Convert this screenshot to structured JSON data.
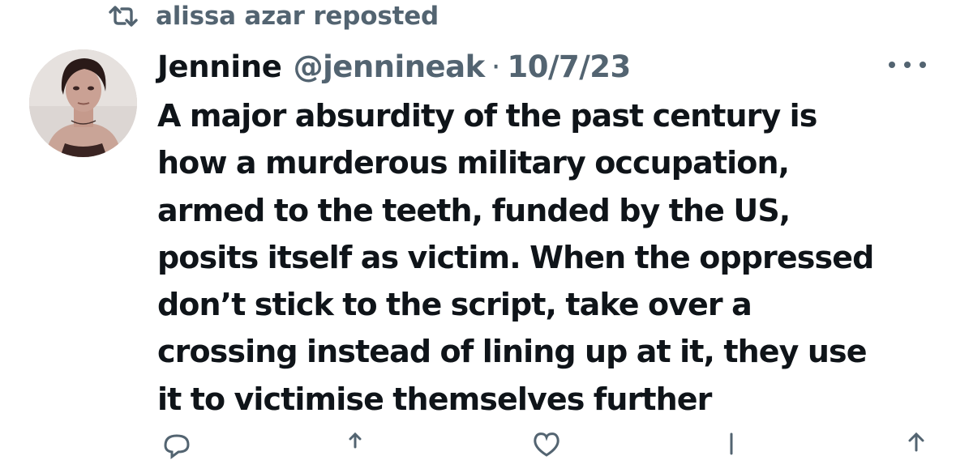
{
  "repost": {
    "icon": "repost-icon",
    "label": "alissa azar reposted"
  },
  "tweet": {
    "display_name": "Jennine",
    "handle": "@jennineak",
    "separator": "·",
    "date": "10/7/23",
    "body_lines": [
      "A major absurdity of the past century is",
      "how a murderous military occupation,",
      "armed to the teeth, funded by the US,",
      "posits itself as victim. When the oppressed",
      "don’t stick to the script, take over a",
      "crossing instead of lining up at it, they use",
      "it to victimise themselves further"
    ]
  },
  "icons": {
    "more": "more-options-icon",
    "reply": "reply-icon",
    "repost": "repost-icon",
    "like": "like-icon",
    "views": "views-icon",
    "share": "share-icon"
  },
  "colors": {
    "text_primary": "#0f1419",
    "text_secondary": "#536471",
    "background": "#ffffff"
  }
}
